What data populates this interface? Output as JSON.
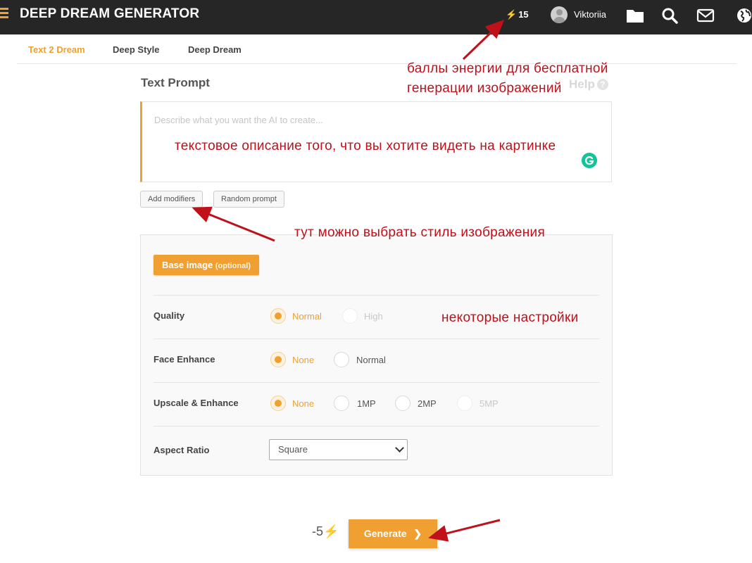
{
  "header": {
    "brand": "DEEP DREAM GENERATOR",
    "energy_count": "15",
    "username": "Viktoriia",
    "icons": [
      "folder-icon",
      "search-icon",
      "mail-icon",
      "globe-icon"
    ]
  },
  "tabs": [
    {
      "label": "Text 2 Dream",
      "active": true
    },
    {
      "label": "Deep Style",
      "active": false
    },
    {
      "label": "Deep Dream",
      "active": false
    }
  ],
  "prompt": {
    "title": "Text Prompt",
    "help_label": "Help",
    "placeholder": "Describe what you want the AI to create...",
    "add_modifiers_label": "Add modifiers",
    "random_prompt_label": "Random prompt"
  },
  "settings": {
    "base_image_label": "Base image",
    "base_image_optional": "(optional)",
    "quality": {
      "label": "Quality",
      "options": [
        "Normal",
        "High"
      ],
      "selected": "Normal"
    },
    "face_enhance": {
      "label": "Face Enhance",
      "options": [
        "None",
        "Normal"
      ],
      "selected": "None"
    },
    "upscale": {
      "label": "Upscale & Enhance",
      "options": [
        "None",
        "1MP",
        "2MP",
        "5MP"
      ],
      "selected": "None"
    },
    "aspect_ratio": {
      "label": "Aspect Ratio",
      "value": "Square"
    }
  },
  "footer": {
    "cost": "-5",
    "generate_label": "Generate"
  },
  "annotations": {
    "energy_note_line1": "баллы энергии для бесплатной",
    "energy_note_line2": "генерации изображений",
    "prompt_note": "текстовое описание того, что вы хотите видеть на картинке",
    "style_note": "тут можно выбрать стиль изображения",
    "settings_note": "некоторые настройки"
  },
  "colors": {
    "accent": "#f0a030",
    "topbar": "#262626",
    "annotation": "#c0101a",
    "grammarly": "#15c39a"
  }
}
